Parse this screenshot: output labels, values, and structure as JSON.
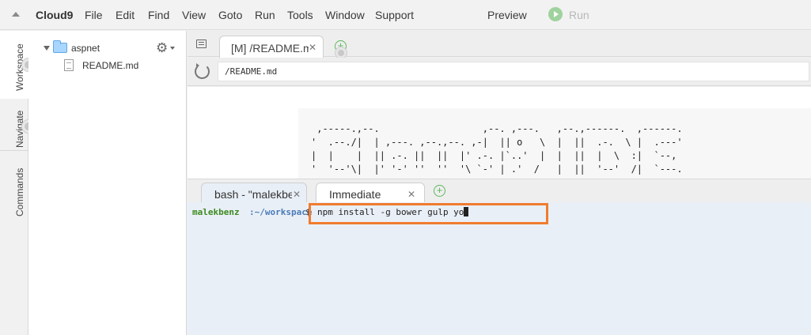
{
  "menubar": {
    "brand": "Cloud9",
    "items": [
      "File",
      "Edit",
      "Find",
      "View",
      "Goto",
      "Run",
      "Tools",
      "Window",
      "Support"
    ],
    "preview": "Preview",
    "run": "Run"
  },
  "rail": {
    "tabs": [
      "Workspace",
      "Navigate",
      "Commands"
    ]
  },
  "tree": {
    "root": "aspnet",
    "files": [
      "README.md"
    ]
  },
  "editor": {
    "tab_label": "[M] /README.m",
    "url": "/README.md",
    "ascii_art": " ,-----.,--.                  ,--. ,---.   ,--.,------.  ,------.\n'  .--./|  | ,---. ,--.,--. ,-|  || o   \\  |  ||  .-.  \\ |  .---'\n|  |    |  || .-. ||  ||  |' .-. |`..'  |  |  ||  |  \\  :|  `--,\n'  '--'\\|  |' '-' ''  ''  '\\ `-' | .'  /   |  ||  '--'  /|  `---."
  },
  "terminal": {
    "tabs": [
      {
        "label": "bash - \"malekbenz"
      },
      {
        "label": "Immediate"
      }
    ],
    "prompt_user": "malekbenz",
    "prompt_path": ":~/workspace",
    "prompt_sep": "$",
    "command": "npm install -g bower gulp yo"
  },
  "colors": {
    "highlight": "#f07c2e",
    "prompt_user": "#3c8a1f",
    "prompt_path": "#4a7bb7",
    "run_button": "#9fd29e"
  }
}
